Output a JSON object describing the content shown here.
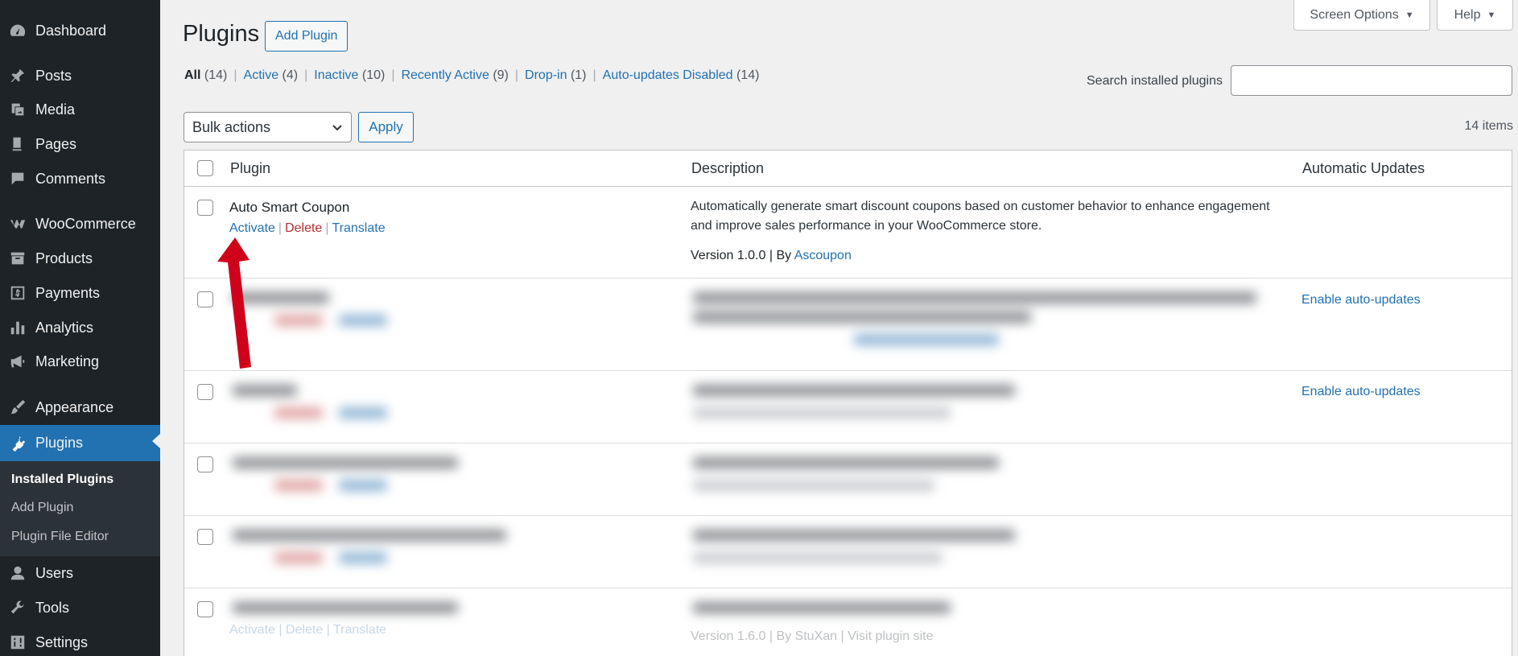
{
  "sidebar": {
    "items": [
      {
        "label": "Dashboard",
        "icon": "dashboard-icon"
      },
      {
        "label": "Posts",
        "icon": "pin-icon"
      },
      {
        "label": "Media",
        "icon": "media-icon"
      },
      {
        "label": "Pages",
        "icon": "pages-icon"
      },
      {
        "label": "Comments",
        "icon": "comment-icon"
      },
      {
        "label": "WooCommerce",
        "icon": "woocommerce-icon"
      },
      {
        "label": "Products",
        "icon": "archive-icon"
      },
      {
        "label": "Payments",
        "icon": "dollar-icon"
      },
      {
        "label": "Analytics",
        "icon": "bar-chart-icon"
      },
      {
        "label": "Marketing",
        "icon": "megaphone-icon"
      },
      {
        "label": "Appearance",
        "icon": "brush-icon"
      },
      {
        "label": "Plugins",
        "icon": "plug-icon",
        "active": true
      },
      {
        "label": "Users",
        "icon": "user-icon"
      },
      {
        "label": "Tools",
        "icon": "wrench-icon"
      },
      {
        "label": "Settings",
        "icon": "settings-icon"
      }
    ],
    "submenu": [
      {
        "label": "Installed Plugins",
        "current": true
      },
      {
        "label": "Add Plugin"
      },
      {
        "label": "Plugin File Editor"
      }
    ]
  },
  "header": {
    "screen_options": "Screen Options",
    "help": "Help",
    "title": "Plugins",
    "add_plugin": "Add Plugin"
  },
  "filters": [
    {
      "label": "All",
      "count": "(14)",
      "current": true
    },
    {
      "label": "Active",
      "count": "(4)"
    },
    {
      "label": "Inactive",
      "count": "(10)"
    },
    {
      "label": "Recently Active",
      "count": "(9)"
    },
    {
      "label": "Drop-in",
      "count": "(1)"
    },
    {
      "label": "Auto-updates Disabled",
      "count": "(14)"
    }
  ],
  "search": {
    "label": "Search installed plugins",
    "value": ""
  },
  "bulk": {
    "selected": "Bulk actions",
    "apply": "Apply"
  },
  "items_count": "14 items",
  "table": {
    "columns": [
      "Plugin",
      "Description",
      "Automatic Updates"
    ],
    "first_row": {
      "name": "Auto Smart Coupon",
      "actions": [
        "Activate",
        "Delete",
        "Translate"
      ],
      "description": "Automatically generate smart discount coupons based on customer behavior to enhance engagement and improve sales performance in your WooCommerce store.",
      "version_prefix": "Version 1.0.0 | By",
      "author": "Ascoupon"
    },
    "auto_updates_link": "Enable auto-updates",
    "last_row_faint": {
      "actions": "Activate | Delete | Translate",
      "version": "Version 1.6.0 | By StuXan | Visit plugin site"
    }
  },
  "colors": {
    "sidebar_bg": "#1d2327",
    "accent": "#2271b1",
    "delete": "#b32d2e",
    "arrow": "#d0021b"
  }
}
